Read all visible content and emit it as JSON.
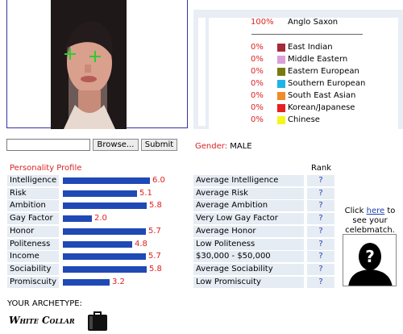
{
  "ethnicity": {
    "top": {
      "percent": "100%",
      "label": "Anglo Saxon",
      "color": "#ffffff"
    },
    "others": [
      {
        "percent": "0%",
        "label": "East Indian",
        "color": "#a52a3a"
      },
      {
        "percent": "0%",
        "label": "Middle Eastern",
        "color": "#d9a0d9"
      },
      {
        "percent": "0%",
        "label": "Eastern European",
        "color": "#7a7a10"
      },
      {
        "percent": "0%",
        "label": "Southern European",
        "color": "#1fb4e8"
      },
      {
        "percent": "0%",
        "label": "South East Asian",
        "color": "#f08a2a"
      },
      {
        "percent": "0%",
        "label": "Korean/Japanese",
        "color": "#e81f1f"
      },
      {
        "percent": "0%",
        "label": "Chinese",
        "color": "#f5f51f"
      }
    ]
  },
  "upload": {
    "file_value": "",
    "browse_label": "Browse...",
    "submit_label": "Submit"
  },
  "gender": {
    "label": "Gender:",
    "value": "MALE"
  },
  "profile": {
    "title": "Personality Profile",
    "rank_header": "Rank",
    "max_score": 10,
    "traits": [
      {
        "label": "Intelligence",
        "score": 6.0,
        "score_text": "6.0",
        "description": "Average Intelligence",
        "rank": "?"
      },
      {
        "label": "Risk",
        "score": 5.1,
        "score_text": "5.1",
        "description": "Average Risk",
        "rank": "?"
      },
      {
        "label": "Ambition",
        "score": 5.8,
        "score_text": "5.8",
        "description": "Average Ambition",
        "rank": "?"
      },
      {
        "label": "Gay Factor",
        "score": 2.0,
        "score_text": "2.0",
        "description": "Very Low Gay Factor",
        "rank": "?"
      },
      {
        "label": "Honor",
        "score": 5.7,
        "score_text": "5.7",
        "description": "Average Honor",
        "rank": "?"
      },
      {
        "label": "Politeness",
        "score": 4.8,
        "score_text": "4.8",
        "description": "Low Politeness",
        "rank": "?"
      },
      {
        "label": "Income",
        "score": 5.7,
        "score_text": "5.7",
        "description": "$30,000 - $50,000",
        "rank": "?"
      },
      {
        "label": "Sociability",
        "score": 5.8,
        "score_text": "5.8",
        "description": "Average Sociability",
        "rank": "?"
      },
      {
        "label": "Promiscuity",
        "score": 3.2,
        "score_text": "3.2",
        "description": "Low Promiscuity",
        "rank": "?"
      }
    ]
  },
  "celebmatch": {
    "text_before": "Click ",
    "link_text": "here",
    "text_after": " to see your celebmatch."
  },
  "archetype": {
    "label": "YOUR ARCHETYPE:",
    "name": "White Collar"
  },
  "colors": {
    "accent_red": "#dd2222",
    "bar_blue": "#1f49b5",
    "link_blue": "#1f3fb0",
    "row_bg": "#e6ecf4"
  }
}
